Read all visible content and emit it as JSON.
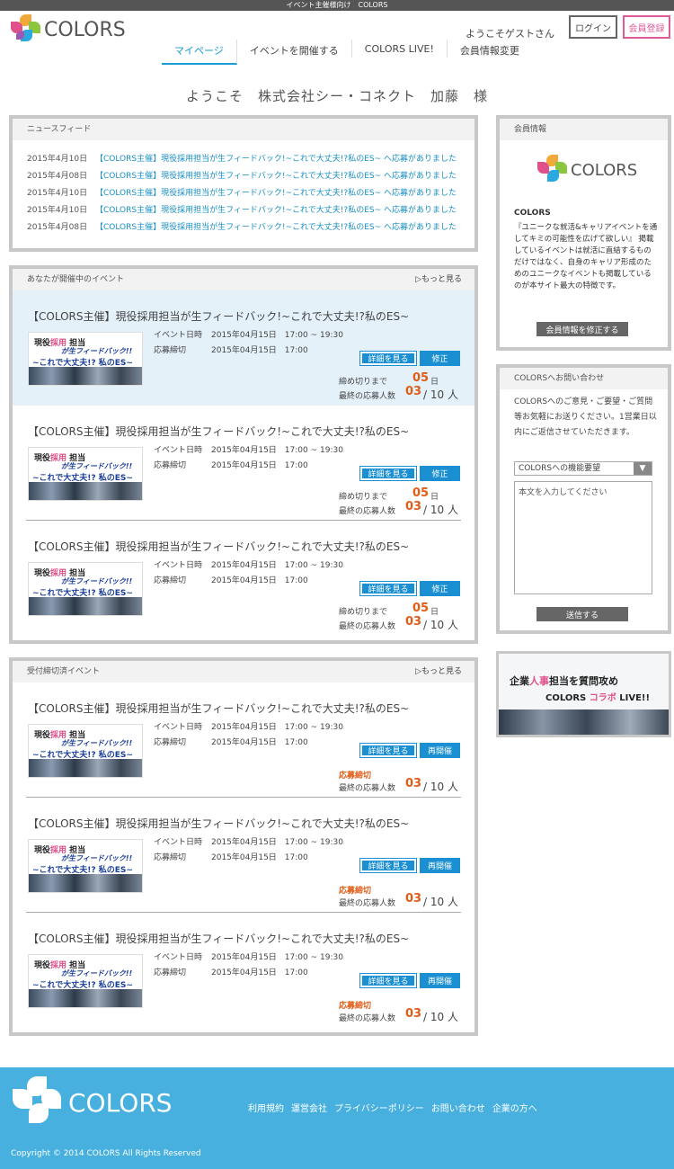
{
  "top_strip": "イベント主催様向け　COLORS",
  "header": {
    "logo_text": "COLORS",
    "welcome": "ようこそゲストさん",
    "login": "ログイン",
    "register": "会員登録"
  },
  "nav": [
    {
      "label": "マイページ",
      "active": true
    },
    {
      "label": "イベントを開催する",
      "active": false
    },
    {
      "label": "COLORS LIVE!",
      "active": false
    },
    {
      "label": "会員情報変更",
      "active": false
    }
  ],
  "greeting": "ようこそ　株式会社シー・コネクト　加藤　様",
  "news": {
    "title": "ニュースフィード",
    "items": [
      {
        "date": "2015年4月10日",
        "text": "【COLORS主催】現役採用担当が生フィードバック!~これで大丈夫!?私のES~ へ応募がありました"
      },
      {
        "date": "2015年4月08日",
        "text": "【COLORS主催】現役採用担当が生フィードバック!~これで大丈夫!?私のES~ へ応募がありました"
      },
      {
        "date": "2015年4月10日",
        "text": "【COLORS主催】現役採用担当が生フィードバック!~これで大丈夫!?私のES~ へ応募がありました"
      },
      {
        "date": "2015年4月10日",
        "text": "【COLORS主催】現役採用担当が生フィードバック!~これで大丈夫!?私のES~ へ応募がありました"
      },
      {
        "date": "2015年4月08日",
        "text": "【COLORS主催】現役採用担当が生フィードバック!~これで大丈夫!?私のES~ へ応募がありました"
      }
    ]
  },
  "thumb": {
    "line1a": "現役",
    "line1b": "採用",
    "line1c": " 担当",
    "line2": "が生フィードバック!!",
    "line3": "~これで大丈夫!? 私のES~"
  },
  "open_events": {
    "title": "あなたが開催中のイベント",
    "more": "▷もっと見る",
    "items": [
      {
        "title": "【COLORS主催】現役採用担当が生フィードバック!~これで大丈夫!?私のES~",
        "date_label": "イベント日時",
        "date": "2015年04月15日　17:00 ~ 19:30",
        "deadline_label": "応募締切",
        "deadline": "2015年04月15日　17:00",
        "detail": "詳細を見る",
        "action": "修正",
        "remain_label": "締め切りまで",
        "remain": "05",
        "remain_unit": "日",
        "final_label": "最終の応募人数",
        "final_cur": "03",
        "final_rest": "/ 10 人"
      },
      {
        "title": "【COLORS主催】現役採用担当が生フィードバック!~これで大丈夫!?私のES~",
        "date_label": "イベント日時",
        "date": "2015年04月15日　17:00 ~ 19:30",
        "deadline_label": "応募締切",
        "deadline": "2015年04月15日　17:00",
        "detail": "詳細を見る",
        "action": "修正",
        "remain_label": "締め切りまで",
        "remain": "05",
        "remain_unit": "日",
        "final_label": "最終の応募人数",
        "final_cur": "03",
        "final_rest": "/ 10 人"
      },
      {
        "title": "【COLORS主催】現役採用担当が生フィードバック!~これで大丈夫!?私のES~",
        "date_label": "イベント日時",
        "date": "2015年04月15日　17:00 ~ 19:30",
        "deadline_label": "応募締切",
        "deadline": "2015年04月15日　17:00",
        "detail": "詳細を見る",
        "action": "修正",
        "remain_label": "締め切りまで",
        "remain": "05",
        "remain_unit": "日",
        "final_label": "最終の応募人数",
        "final_cur": "03",
        "final_rest": "/ 10 人"
      }
    ]
  },
  "closed_events": {
    "title": "受付締切済イベント",
    "more": "▷もっと見る",
    "items": [
      {
        "title": "【COLORS主催】現役採用担当が生フィードバック!~これで大丈夫!?私のES~",
        "date_label": "イベント日時",
        "date": "2015年04月15日　17:00 ~ 19:30",
        "deadline_label": "応募締切",
        "deadline": "2015年04月15日　17:00",
        "detail": "詳細を見る",
        "action": "再開催",
        "closed": "応募締切",
        "final_label": "最終の応募人数",
        "final_cur": "03",
        "final_rest": "/ 10 人"
      },
      {
        "title": "【COLORS主催】現役採用担当が生フィードバック!~これで大丈夫!?私のES~",
        "date_label": "イベント日時",
        "date": "2015年04月15日　17:00 ~ 19:30",
        "deadline_label": "応募締切",
        "deadline": "2015年04月15日　17:00",
        "detail": "詳細を見る",
        "action": "再開催",
        "closed": "応募締切",
        "final_label": "最終の応募人数",
        "final_cur": "03",
        "final_rest": "/ 10 人"
      },
      {
        "title": "【COLORS主催】現役採用担当が生フィードバック!~これで大丈夫!?私のES~",
        "date_label": "イベント日時",
        "date": "2015年04月15日　17:00 ~ 19:30",
        "deadline_label": "応募締切",
        "deadline": "2015年04月15日　17:00",
        "detail": "詳細を見る",
        "action": "再開催",
        "closed": "応募締切",
        "final_label": "最終の応募人数",
        "final_cur": "03",
        "final_rest": "/ 10 人"
      }
    ]
  },
  "member_info": {
    "title": "会員情報",
    "logo_text": "COLORS",
    "name": "COLORS",
    "text": "『ユニークな就活&キャリアイベントを通してキミの可能性を広げて欲しい』 掲載しているイベントは就活に直結するものだけではなく、自身のキャリア形成のためのユニークなイベントも掲載しているのが本サイト最大の特徴です。",
    "button": "会員情報を修正する"
  },
  "contact": {
    "title": "COLORSへお問い合わせ",
    "text": "COLORSへのご意見・ご要望・ご質問等お気軽にお送りください。1営業日以内にご返信させていただきます。",
    "select": "COLORSへの機能要望",
    "placeholder": "本文を入力してください",
    "submit": "送信する"
  },
  "banner": {
    "t1a": "企業",
    "t1b": "人事",
    "t1c": "担当を質問攻め",
    "t2a": "COLORS ",
    "t2b": "コラボ",
    "t2c": " LIVE!!"
  },
  "footer": {
    "logo_text": "COLORS",
    "links": [
      "利用規約",
      "運営会社",
      "プライバシーポリシー",
      "お問い合わせ",
      "企業の方へ"
    ],
    "copyright": "Copyright © 2014 COLORS All Rights Reserved"
  },
  "colors": {
    "accent": "#1a8fd1",
    "pink": "#e0508a",
    "orange": "#e05d18",
    "footer": "#47b0df"
  }
}
